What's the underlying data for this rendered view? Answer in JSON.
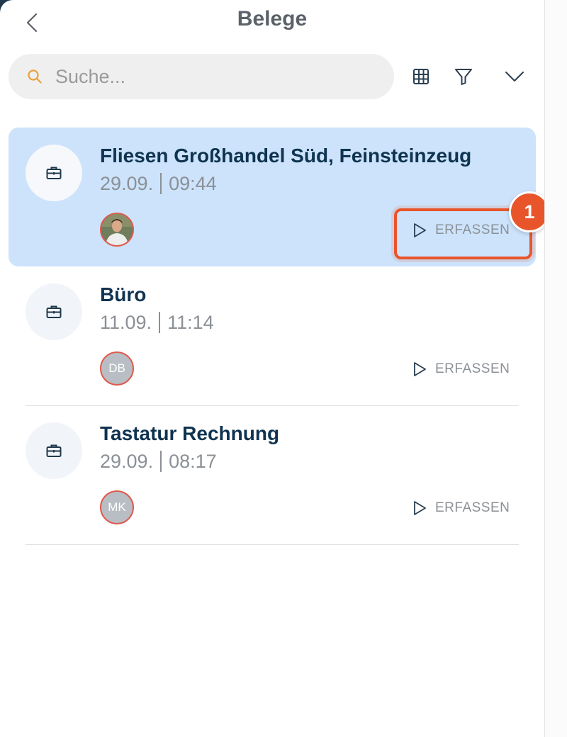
{
  "header": {
    "title": "Belege"
  },
  "search": {
    "placeholder": "Suche..."
  },
  "toolbar": {
    "icons": [
      "table-icon",
      "filter-icon",
      "chevron-down-icon"
    ]
  },
  "items": [
    {
      "title": "Fliesen Großhandel Süd, Feinsteinzeug",
      "date": "29.09.",
      "time": "09:44",
      "avatar_initials": "",
      "avatar_type": "photo",
      "action_label": "ERFASSEN",
      "selected": true
    },
    {
      "title": "Büro",
      "date": "11.09.",
      "time": "11:14",
      "avatar_initials": "DB",
      "avatar_type": "initials",
      "action_label": "ERFASSEN",
      "selected": false
    },
    {
      "title": "Tastatur Rechnung",
      "date": "29.09.",
      "time": "08:17",
      "avatar_initials": "MK",
      "avatar_type": "initials",
      "action_label": "ERFASSEN",
      "selected": false
    }
  ],
  "annotation": {
    "step": "1",
    "color": "#e9552a"
  },
  "colors": {
    "selected_bg": "#cce3fb",
    "title": "#0f3350",
    "accent": "#e9552a",
    "search_icon": "#e8a13a"
  }
}
